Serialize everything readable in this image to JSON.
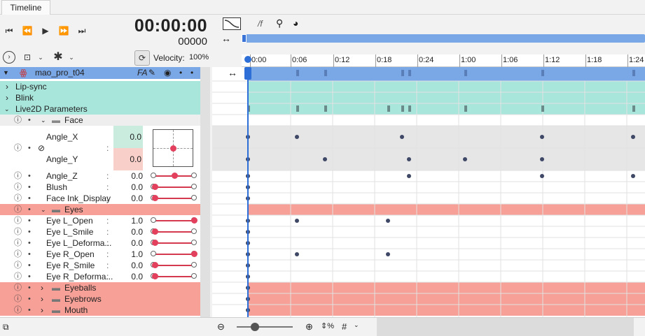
{
  "tab_title": "Timeline",
  "timecode": "00:00:00",
  "frame_number": "00000",
  "velocity_label": "Velocity:",
  "velocity_value": "100%",
  "fps_label": "/f",
  "ruler_labels": [
    "0:00",
    "0:06",
    "0:12",
    "0:18",
    "0:24",
    "1:00",
    "1:06",
    "1:12",
    "1:18",
    "1:24"
  ],
  "rows": {
    "model": {
      "label": "mao_pro_t04",
      "badge": "FA"
    },
    "lipsync": {
      "label": "Lip-sync"
    },
    "blink": {
      "label": "Blink"
    },
    "params": {
      "label": "Live2D Parameters"
    },
    "face": {
      "label": "Face"
    },
    "angle_x": {
      "label": "Angle_X",
      "value": "0.0"
    },
    "angle_y": {
      "label": "Angle_Y",
      "value": "0.0"
    },
    "angle_z": {
      "label": "Angle_Z",
      "value": "0.0"
    },
    "blush": {
      "label": "Blush",
      "value": "0.0"
    },
    "face_ink": {
      "label": "Face Ink_Display",
      "value": "0.0"
    },
    "eyes": {
      "label": "Eyes"
    },
    "eye_l_open": {
      "label": "Eye L_Open",
      "value": "1.0"
    },
    "eye_l_smile": {
      "label": "Eye L_Smile",
      "value": "0.0"
    },
    "eye_l_deform": {
      "label": "Eye L_Deforma...",
      "value": "0.0"
    },
    "eye_r_open": {
      "label": "Eye R_Open",
      "value": "1.0"
    },
    "eye_r_smile": {
      "label": "Eye R_Smile",
      "value": "0.0"
    },
    "eye_r_deform": {
      "label": "Eye R_Deforma...",
      "value": "0.0"
    },
    "eyeballs": {
      "label": "Eyeballs"
    },
    "eyebrows": {
      "label": "Eyebrows"
    },
    "mouth": {
      "label": "Mouth"
    }
  },
  "colors": {
    "accent": "#5b8fe0",
    "model_row": "#7aa7e6",
    "teal": "#a8e6dc",
    "salmon": "#f7a097",
    "playhead": "#2d6fd6"
  },
  "slider_levels": {
    "angle_z": 0.5,
    "blush": 0.0,
    "face_ink": 0.0,
    "eye_l_open": 1.0,
    "eye_l_smile": 0.0,
    "eye_l_deform": 0.0,
    "eye_r_open": 1.0,
    "eye_r_smile": 0.0,
    "eye_r_deform": 0.0
  }
}
